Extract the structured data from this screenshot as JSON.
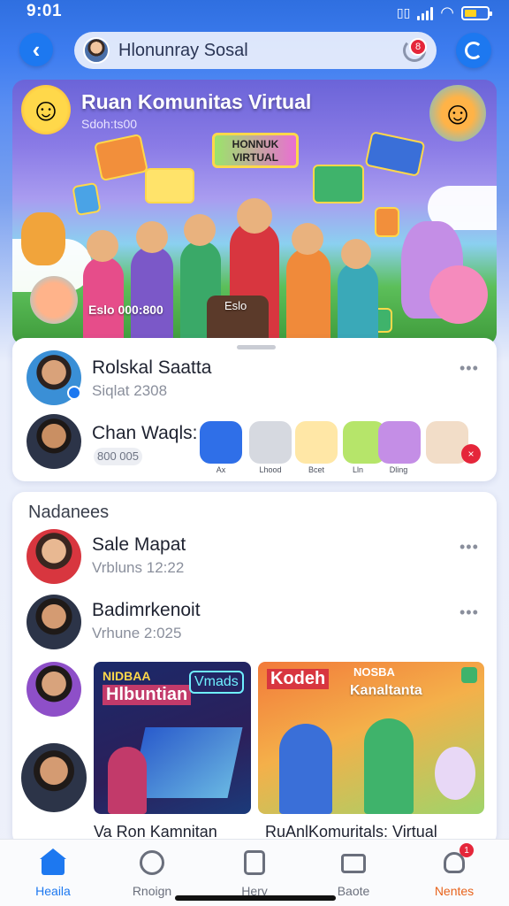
{
  "status_bar": {
    "time": "9:01"
  },
  "header": {
    "title": "Hlonunray Sosal",
    "notification_count": "8"
  },
  "hero": {
    "title": "Ruan Komunitas Virtual",
    "subtitle": "Sdoh:ts00",
    "sign_text": "HONNUK VIRTUAL",
    "stat_left": "Eslo 000:800",
    "stat_right": "Eslo"
  },
  "card1": {
    "rows": [
      {
        "name": "Rolskal Saatta",
        "sub": "Siqlat 2308"
      },
      {
        "name": "Chan Waqls:",
        "sub": "800 005"
      }
    ],
    "apps": [
      {
        "label": "Ax",
        "color": "#2f6fe8"
      },
      {
        "label": "Lhood",
        "color": "#d6d9e0"
      },
      {
        "label": "Bcet",
        "color": "#ffe7a6"
      },
      {
        "label": "Lln",
        "color": "#b6e56a"
      },
      {
        "label": "Dling",
        "color": "#c48ee6"
      },
      {
        "label": "",
        "color": "#f2ddc8"
      }
    ],
    "more_label": "•••"
  },
  "card2": {
    "section_title": "Nadanees",
    "rows": [
      {
        "name": "Sale Mapat",
        "sub": "Vrbluns 12:22"
      },
      {
        "name": "Badimrkenoit",
        "sub": "Vrhune 2:025"
      }
    ],
    "tiles": [
      {
        "top_text": "NIDBAA",
        "title": "Hlbuntian",
        "tag": "Vmads",
        "caption": "Va Ron Kamnitan"
      },
      {
        "top_text": "NOSBA",
        "title": "Kodeh",
        "tag": "Kanaltanta",
        "caption": "RuAnlKomuritals: Virtual"
      }
    ]
  },
  "bottom_nav": [
    {
      "label": "Heaila",
      "active": true
    },
    {
      "label": "Rnoign",
      "active": false
    },
    {
      "label": "Hery",
      "active": false
    },
    {
      "label": "Baote",
      "active": false
    },
    {
      "label": "Nentes",
      "active": false,
      "badge": "1"
    }
  ],
  "colors": {
    "accent": "#1d78f0",
    "badge": "#e5263a",
    "nav_active": "#1d78f0",
    "nav_alert": "#e8631c"
  }
}
